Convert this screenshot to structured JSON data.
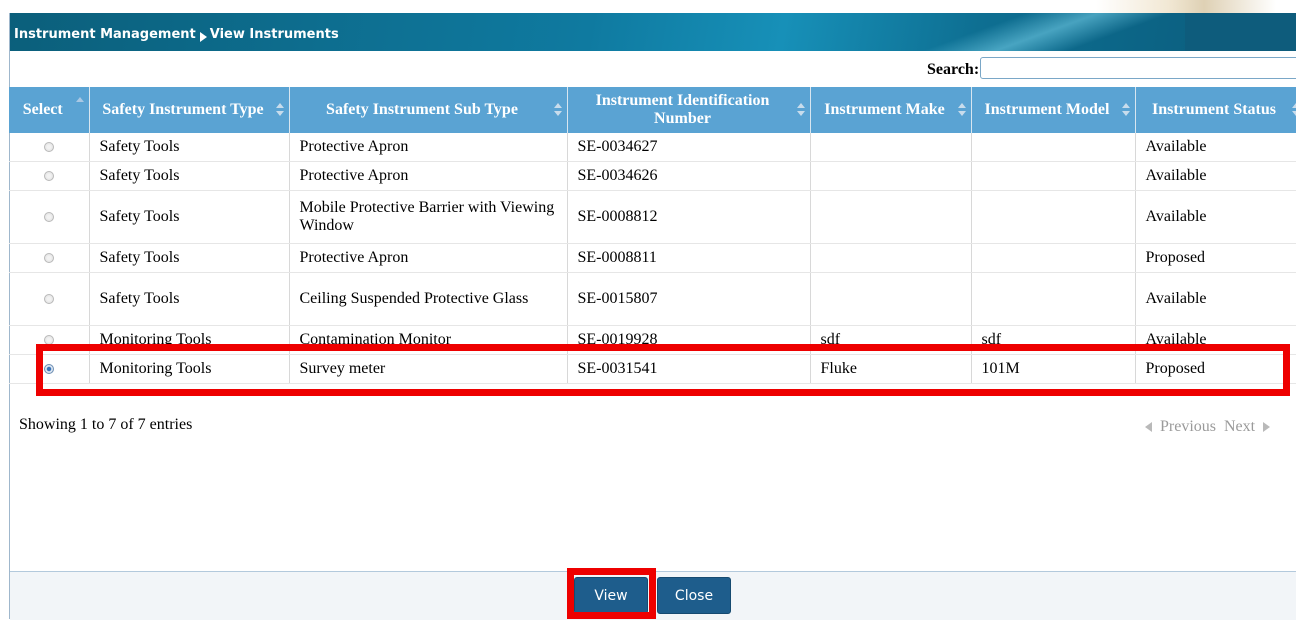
{
  "breadcrumb": {
    "section": "Instrument Management",
    "page": "View Instruments"
  },
  "search": {
    "label": "Search:",
    "value": ""
  },
  "table": {
    "headers": {
      "select": "Select",
      "type": "Safety Instrument Type",
      "subtype": "Safety Instrument Sub Type",
      "id": "Instrument Identification Number",
      "make": "Instrument Make",
      "model": "Instrument Model",
      "status": "Instrument Status"
    },
    "rows": [
      {
        "type": "Safety Tools",
        "subtype": "Protective Apron",
        "id": "SE-0034627",
        "make": "",
        "model": "",
        "status": "Available",
        "selected": false
      },
      {
        "type": "Safety Tools",
        "subtype": "Protective Apron",
        "id": "SE-0034626",
        "make": "",
        "model": "",
        "status": "Available",
        "selected": false
      },
      {
        "type": "Safety Tools",
        "subtype": "Mobile Protective Barrier with Viewing Window",
        "id": "SE-0008812",
        "make": "",
        "model": "",
        "status": "Available",
        "selected": false
      },
      {
        "type": "Safety Tools",
        "subtype": "Protective Apron",
        "id": "SE-0008811",
        "make": "",
        "model": "",
        "status": "Proposed",
        "selected": false
      },
      {
        "type": "Safety Tools",
        "subtype": "Ceiling Suspended Protective Glass",
        "id": "SE-0015807",
        "make": "",
        "model": "",
        "status": "Available",
        "selected": false
      },
      {
        "type": "Monitoring Tools",
        "subtype": "Contamination Monitor",
        "id": "SE-0019928",
        "make": "sdf",
        "model": "sdf",
        "status": "Available",
        "selected": false
      },
      {
        "type": "Monitoring Tools",
        "subtype": "Survey meter",
        "id": "SE-0031541",
        "make": "Fluke",
        "model": "101M",
        "status": "Proposed",
        "selected": true
      }
    ]
  },
  "info": "Showing 1 to 7 of 7 entries",
  "pager": {
    "previous": "Previous",
    "next": "Next"
  },
  "buttons": {
    "view": "View",
    "close": "Close"
  },
  "colors": {
    "header": "#5aa3d3",
    "button": "#1e5d8c",
    "highlight": "#ee0000"
  }
}
